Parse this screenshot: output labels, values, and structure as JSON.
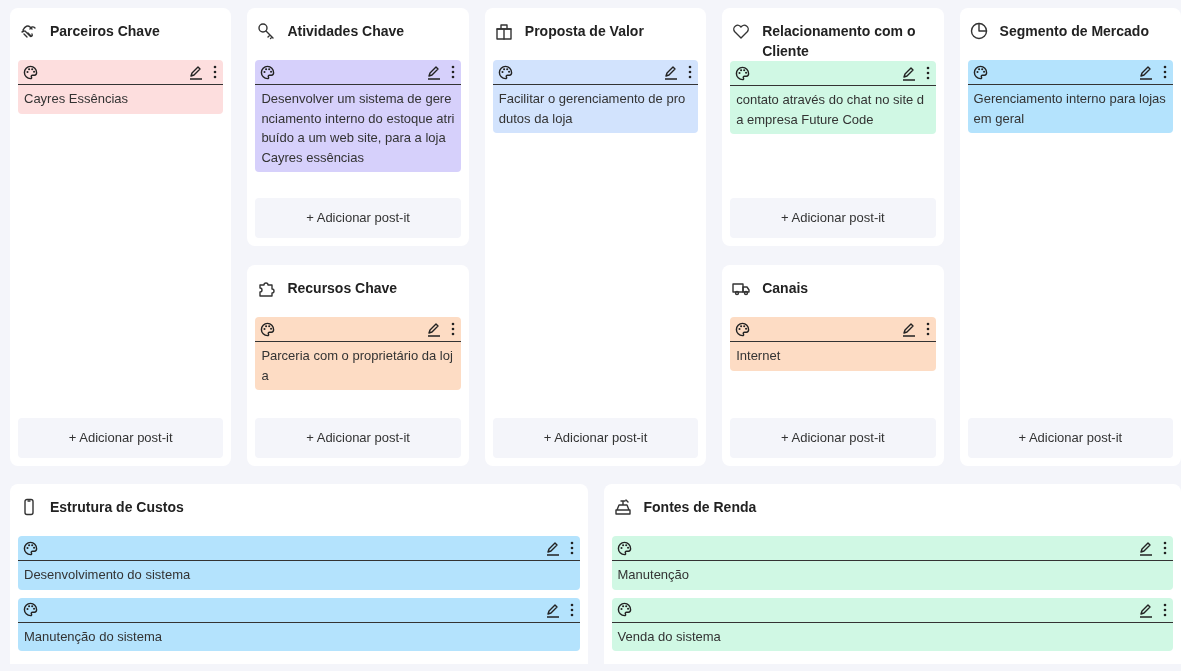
{
  "top_blocks": [
    {
      "title": "Parceiros Chave",
      "postits": [
        {
          "text": "Cayres Essências",
          "color": "#fddede"
        }
      ],
      "add_button": "+ Adicionar post-it"
    },
    {
      "title": "Atividades Chave",
      "postits": [
        {
          "text": "Desenvolver um sistema de gerenciamento interno do estoque atribuído a um web site, para a loja Cayres essências",
          "color": "#d6d0fb"
        }
      ],
      "add_button": "+ Adicionar post-it"
    },
    {
      "title": "Recursos Chave",
      "postits": [
        {
          "text": "Parceria com o proprietário da loja",
          "color": "#fddcc4"
        }
      ],
      "add_button": "+ Adicionar post-it"
    },
    {
      "title": "Proposta de Valor",
      "postits": [
        {
          "text": "Facilitar o gerenciamento de produtos da loja",
          "color": "#d2e3fd"
        }
      ],
      "add_button": "+ Adicionar post-it"
    },
    {
      "title": "Relacionamento com o Cliente",
      "postits": [
        {
          "text": "contato através do chat no site da empresa Future Code",
          "color": "#d0f8e4"
        }
      ],
      "add_button": "+ Adicionar post-it"
    },
    {
      "title": "Canais",
      "postits": [
        {
          "text": "Internet",
          "color": "#fddcc4"
        }
      ],
      "add_button": "+ Adicionar post-it"
    },
    {
      "title": "Segmento de Mercado",
      "postits": [
        {
          "text": "Gerenciamento interno para lojas em geral",
          "color": "#b4e3fd"
        }
      ],
      "add_button": "+ Adicionar post-it"
    }
  ],
  "bottom_blocks": [
    {
      "title": "Estrutura de Custos",
      "postits": [
        {
          "text": "Desenvolvimento do sistema",
          "color": "#b4e3fd"
        },
        {
          "text": "Manutenção do sistema",
          "color": "#b4e3fd"
        }
      ]
    },
    {
      "title": "Fontes de Renda",
      "postits": [
        {
          "text": "Manutenção",
          "color": "#d0f8e4"
        },
        {
          "text": "Venda do sistema",
          "color": "#d0f8e4"
        }
      ]
    }
  ]
}
